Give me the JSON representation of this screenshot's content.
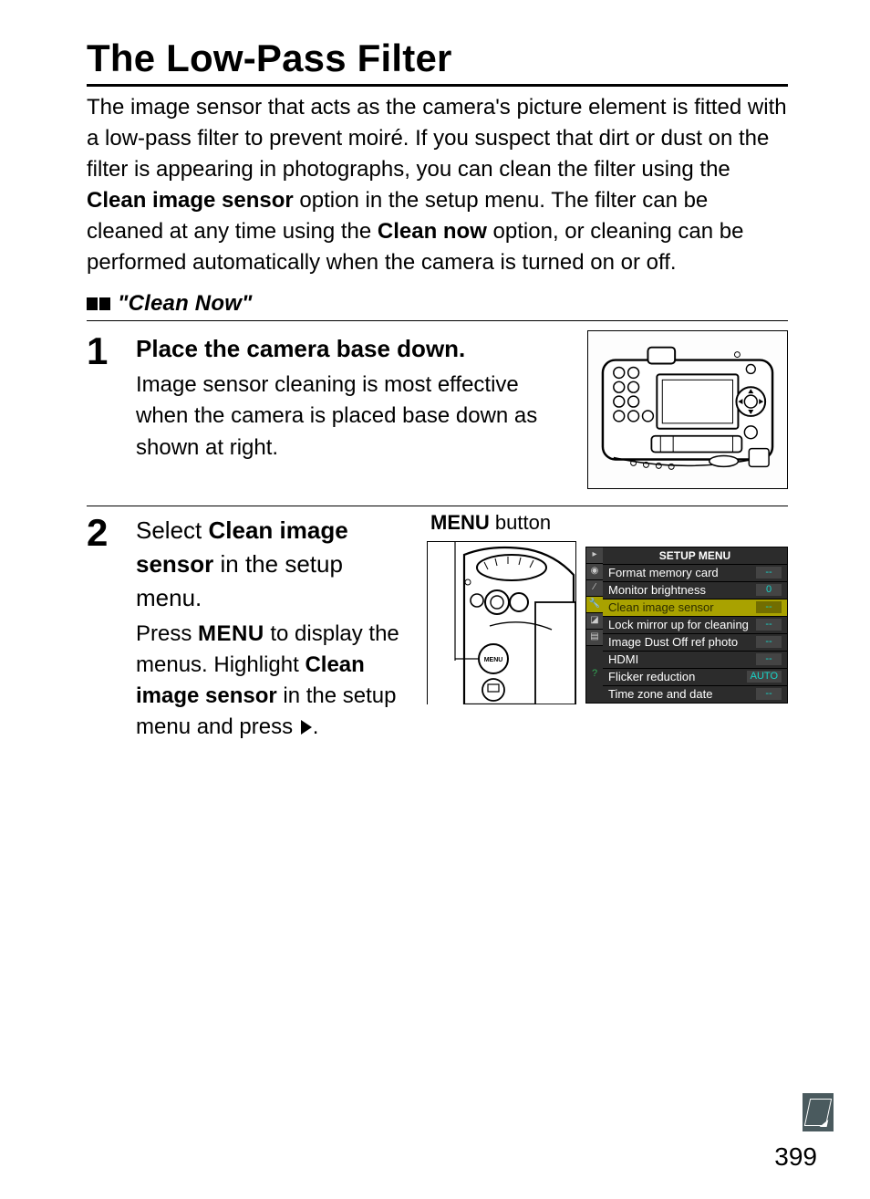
{
  "title": "The Low-Pass Filter",
  "intro_before_b1": "The image sensor that acts as the camera's picture element is fitted with a low-pass filter to prevent moiré.  If you suspect that dirt or dust on the filter is appearing in photographs, you can clean the filter using the ",
  "intro_b1": "Clean image sensor",
  "intro_mid": " option in the setup menu.  The filter can be cleaned at any time using the ",
  "intro_b2": "Clean now",
  "intro_after_b2": " option, or cleaning can be performed automatically when the camera is turned on or off.",
  "subhead": "\"Clean Now\"",
  "step1": {
    "num": "1",
    "title": "Place the camera base down.",
    "body": "Image sensor cleaning is most effective when the camera is placed base down as shown at right."
  },
  "step2": {
    "num": "2",
    "title_pre": "Select ",
    "title_b": "Clean image sensor",
    "title_post": " in the setup menu.",
    "body_pre": "Press ",
    "body_menu": "MENU",
    "body_mid": " to display the menus.  Highlight ",
    "body_b": "Clean image sensor",
    "body_post": " in the setup menu and press ",
    "body_end": ".",
    "fig_label_menu": "MENU",
    "fig_label_button": " button"
  },
  "setup_menu": {
    "title": "SETUP MENU",
    "rows": [
      {
        "label": "Format memory card",
        "val": "--"
      },
      {
        "label": "Monitor brightness",
        "val": "0"
      },
      {
        "label": "Clean image sensor",
        "val": "--",
        "selected": true
      },
      {
        "label": "Lock mirror up for cleaning",
        "val": "--"
      },
      {
        "label": "Image Dust Off ref photo",
        "val": "--"
      },
      {
        "label": "HDMI",
        "val": "--"
      },
      {
        "label": "Flicker reduction",
        "val": "AUTO"
      },
      {
        "label": "Time zone and date",
        "val": "--"
      }
    ]
  },
  "page_number": "399"
}
